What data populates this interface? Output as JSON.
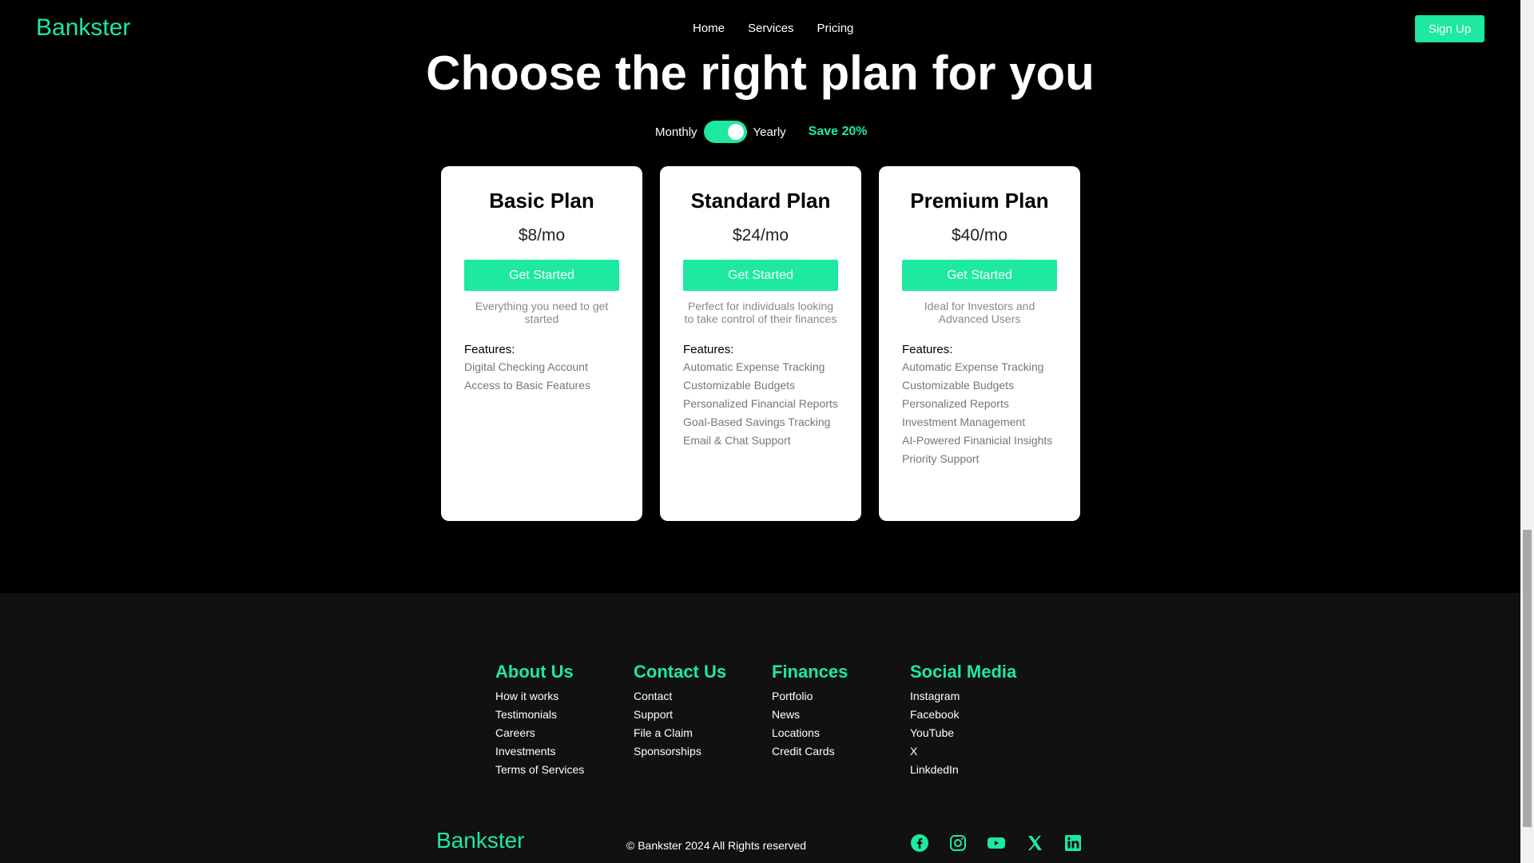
{
  "brand": "Bankster",
  "nav": {
    "items": [
      "Home",
      "Services",
      "Pricing"
    ],
    "signup": "Sign Up"
  },
  "hero": {
    "title": "Choose the right plan for you"
  },
  "billing": {
    "monthly": "Monthly",
    "yearly": "Yearly",
    "save": "Save 20%",
    "yearly_selected": true
  },
  "plans": [
    {
      "name": "Basic Plan",
      "price": "$8/mo",
      "button": "Get Started",
      "description": "Everything you need to get started",
      "features_heading": "Features:",
      "features": [
        "Digital Checking Account",
        "Access to Basic Features"
      ]
    },
    {
      "name": "Standard Plan",
      "price": "$24/mo",
      "button": "Get Started",
      "description": "Perfect for individuals looking to take control of their finances",
      "features_heading": "Features:",
      "features": [
        "Automatic Expense Tracking",
        "Customizable Budgets",
        "Personalized Financial Reports",
        "Goal-Based Savings Tracking",
        "Email & Chat Support"
      ]
    },
    {
      "name": "Premium Plan",
      "price": "$40/mo",
      "button": "Get Started",
      "description": "Ideal for Investors and Advanced Users",
      "features_heading": "Features:",
      "features": [
        "Automatic Expense Tracking",
        "Customizable Budgets",
        "Personalized Reports",
        "Investment Management",
        "AI-Powered Finanicial Insights",
        "Priority Support"
      ]
    }
  ],
  "footer": {
    "columns": [
      {
        "heading": "About Us",
        "links": [
          "How it works",
          "Testimonials",
          "Careers",
          "Investments",
          "Terms of Services"
        ]
      },
      {
        "heading": "Contact Us",
        "links": [
          "Contact",
          "Support",
          "File a Claim",
          "Sponsorships"
        ]
      },
      {
        "heading": "Finances",
        "links": [
          "Portfolio",
          "News",
          "Locations",
          "Credit Cards"
        ]
      },
      {
        "heading": "Social Media",
        "links": [
          "Instagram",
          "Facebook",
          "YouTube",
          "X",
          "LinkdedIn"
        ]
      }
    ],
    "brand": "Bankster",
    "copyright": "© Bankster 2024 All Rights reserved",
    "social_icons": [
      "facebook-icon",
      "instagram-icon",
      "youtube-icon",
      "x-icon",
      "linkedin-icon"
    ]
  },
  "colors": {
    "accent": "#1de9a0",
    "background": "#000000",
    "footer_bg": "#111111",
    "card_bg": "#ffffff"
  }
}
